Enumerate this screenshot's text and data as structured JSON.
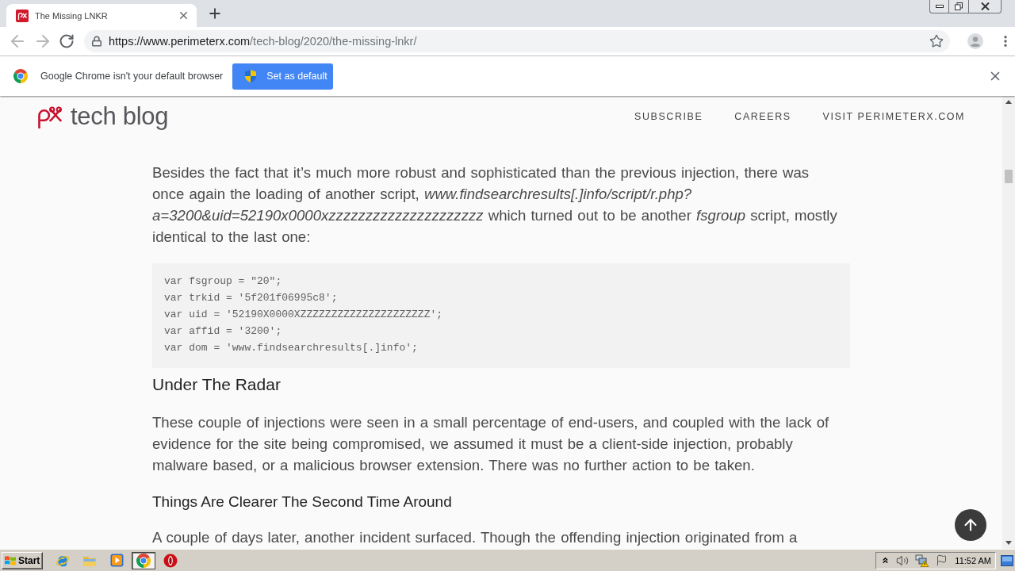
{
  "browser": {
    "tabs": [
      {
        "title": "The Missing LNKR",
        "selected": true
      }
    ],
    "address_bar": {
      "origin": "https://www.perimeterx.com",
      "path": "/tech-blog/2020/the-missing-lnkr/"
    }
  },
  "infobar": {
    "message": "Google Chrome isn't your default browser",
    "button": "Set as default"
  },
  "site_header": {
    "logo_text": "tech blog",
    "nav": [
      "SUBSCRIBE",
      "CAREERS",
      "VISIT PERIMETERX.COM"
    ]
  },
  "article": [
    {
      "kind": "paragraph",
      "text": "Besides the fact that it’s much more robust and sophisticated than the previous injection, there was once again the loading of another script, *www.findsearchresults[.]info/script/r.php?a=3200&uid=52190x0000xzzzzzzzzzzzzzzzzzzzzz* which turned out to be another *fsgroup* script, mostly identical to the last one:"
    },
    {
      "kind": "code",
      "lines": [
        "var fsgroup = \"20\";",
        "var trkid = '5f201f06995c8';",
        "var uid = '52190X0000XZZZZZZZZZZZZZZZZZZZZZ';",
        "var affid = '3200';",
        "var dom = 'www.findsearchresults[.]info';"
      ]
    },
    {
      "kind": "heading",
      "text": "Under The Radar"
    },
    {
      "kind": "paragraph",
      "text": "These couple of injections were seen in a small percentage of end-users, and coupled with the lack of evidence for the site being compromised, we assumed it must be a client-side injection, probably malware based, or a malicious browser extension. There was no further action to be taken."
    },
    {
      "kind": "subheading",
      "text": "Things Are Clearer The Second Time Around"
    },
    {
      "kind": "paragraph",
      "text": "A couple of days later, another incident surfaced. Though the offending injection originated from a"
    }
  ],
  "taskbar": {
    "start": "Start",
    "apps": [
      {
        "kind": "e",
        "selected": false
      },
      {
        "kind": "folder",
        "selected": false
      },
      {
        "kind": "play",
        "selected": false
      },
      {
        "kind": "wheel",
        "selected": true
      },
      {
        "kind": "o",
        "selected": false
      }
    ],
    "clock": "11:52 AM"
  }
}
